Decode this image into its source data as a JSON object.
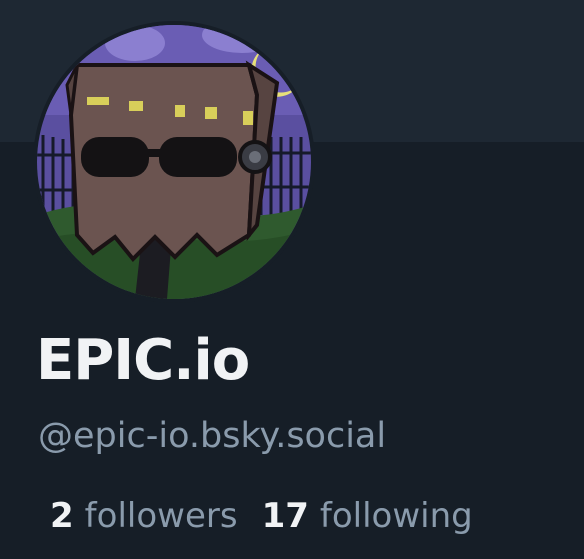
{
  "profile": {
    "display_name": "EPIC.io",
    "handle": "@epic-io.bsky.social",
    "followers_count": "2",
    "followers_label": "followers",
    "following_count": "17",
    "following_label": "following",
    "avatar_description_icon": "paper-bag-head-avatar"
  },
  "colors": {
    "background": "#161e27",
    "banner": "#1e2833",
    "text_primary": "#f1f3f5",
    "text_secondary": "#8a9bac"
  }
}
